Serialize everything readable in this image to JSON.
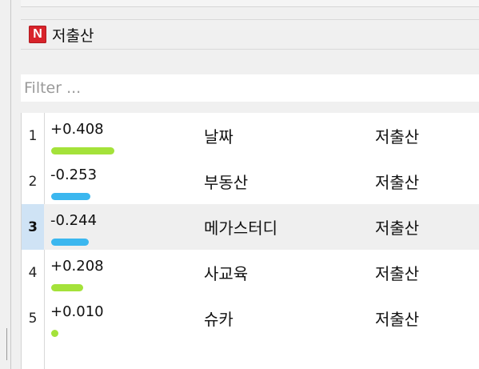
{
  "header": {
    "icon_letter": "N",
    "title": "저출산"
  },
  "filter": {
    "placeholder": "Filter ...",
    "value": ""
  },
  "colors": {
    "positive": "#a4e23a",
    "negative": "#3bb7ef",
    "icon_bg": "#d8232a",
    "selected_row": "#efefef",
    "selected_index": "#cfe3f5"
  },
  "rows": [
    {
      "index": "1",
      "score": "+0.408",
      "weight": 0.408,
      "sign": "positive",
      "term": "날짜",
      "query": "저출산"
    },
    {
      "index": "2",
      "score": "-0.253",
      "weight": 0.253,
      "sign": "negative",
      "term": "부동산",
      "query": "저출산"
    },
    {
      "index": "3",
      "score": "-0.244",
      "weight": 0.244,
      "sign": "negative",
      "term": "메가스터디",
      "query": "저출산",
      "selected": true
    },
    {
      "index": "4",
      "score": "+0.208",
      "weight": 0.208,
      "sign": "positive",
      "term": "사교육",
      "query": "저출산"
    },
    {
      "index": "5",
      "score": "+0.010",
      "weight": 0.01,
      "sign": "positive",
      "term": "슈카",
      "query": "저출산"
    }
  ]
}
